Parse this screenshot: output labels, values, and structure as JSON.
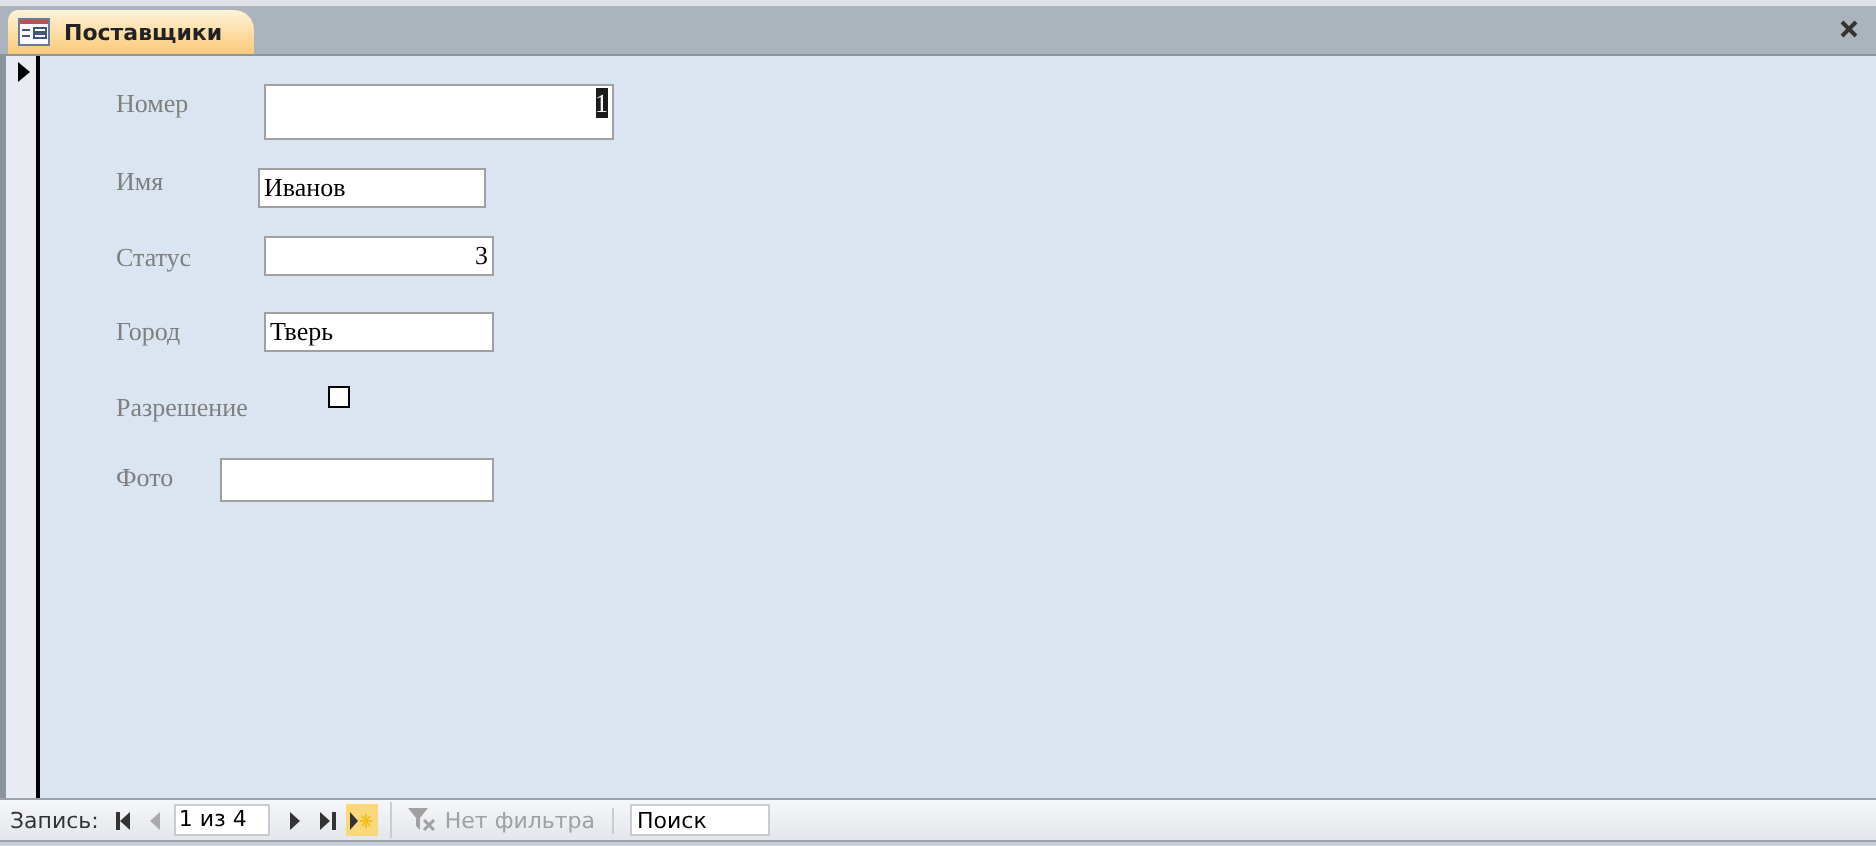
{
  "tab": {
    "title": "Поставщики",
    "selected": true
  },
  "fields": [
    {
      "kind": "number",
      "label": "Номер",
      "value": "1",
      "highlighted": true
    },
    {
      "kind": "text",
      "label": "Имя",
      "value": "Иванов",
      "highlighted": false
    },
    {
      "kind": "number",
      "label": "Статус",
      "value": "3",
      "highlighted": false
    },
    {
      "kind": "text",
      "label": "Город",
      "value": "Тверь",
      "highlighted": false
    },
    {
      "kind": "checkbox",
      "label": "Разрешение",
      "checked": false
    },
    {
      "kind": "text",
      "label": "Фото",
      "highlighted": false
    }
  ],
  "navigation": {
    "label": "Запись:",
    "position": "1 из 4",
    "filter": "Нет фильтра",
    "filter_disabled": true,
    "search_placeholder": "Поиск"
  }
}
